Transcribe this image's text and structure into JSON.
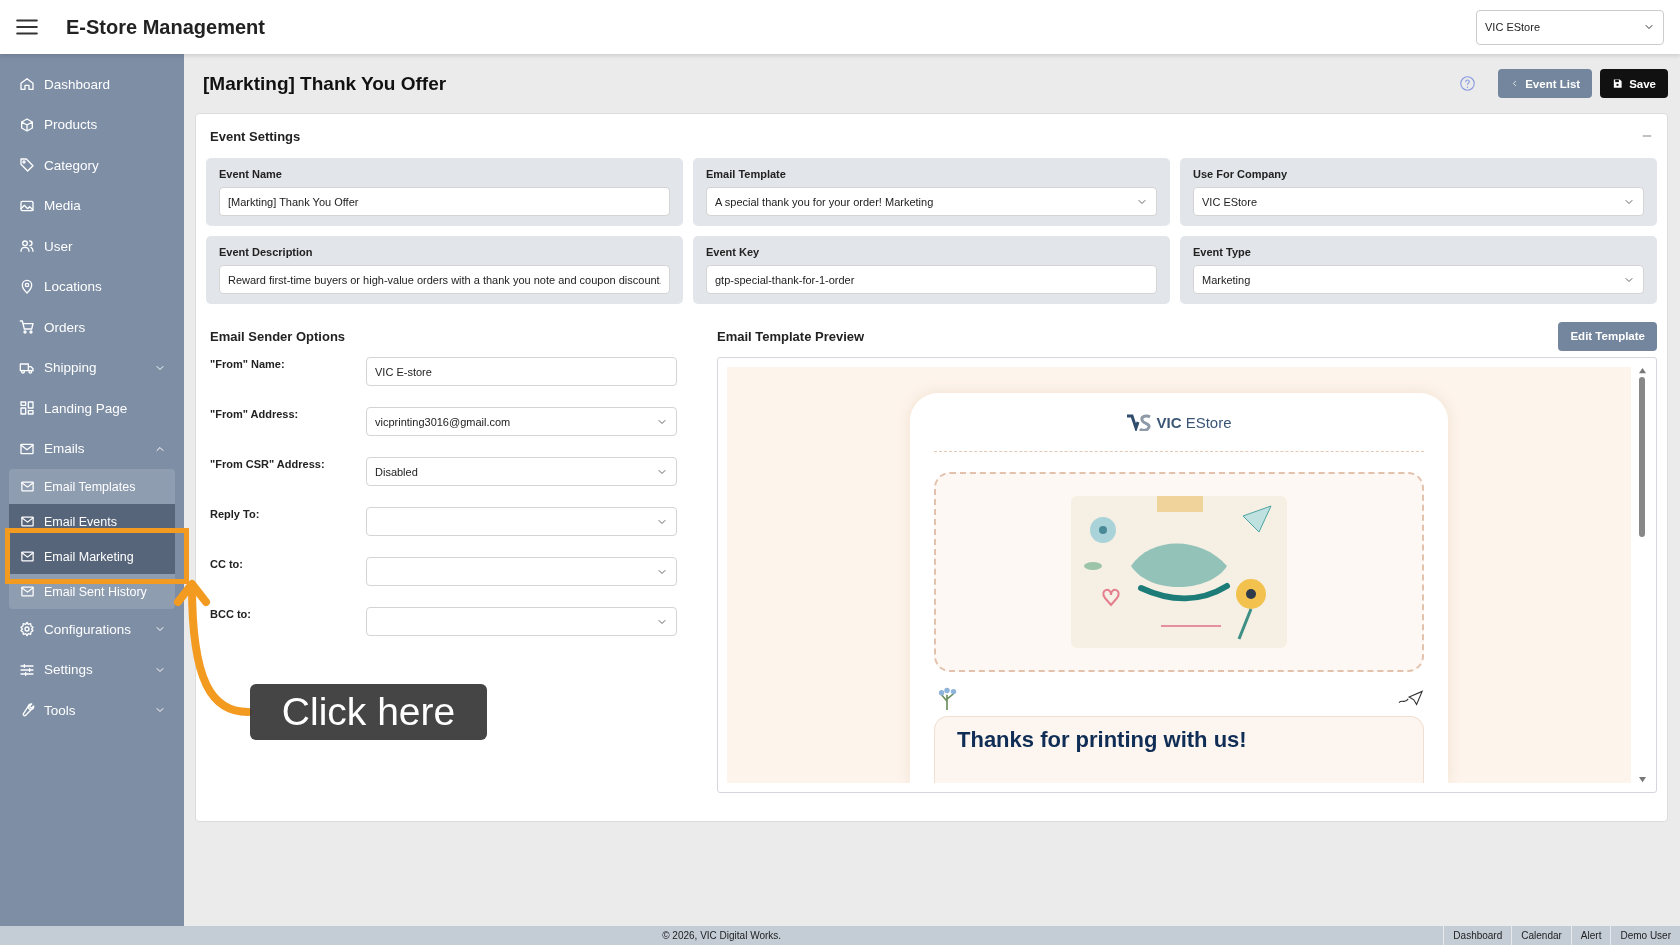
{
  "header": {
    "title": "E-Store Management",
    "store_select": "VIC EStore"
  },
  "sidebar": {
    "items": [
      {
        "kind": "link",
        "label": "Dashboard"
      },
      {
        "kind": "link",
        "label": "Products"
      },
      {
        "kind": "link",
        "label": "Category"
      },
      {
        "kind": "link",
        "label": "Media"
      },
      {
        "kind": "link",
        "label": "User"
      },
      {
        "kind": "link",
        "label": "Locations"
      },
      {
        "kind": "link",
        "label": "Orders"
      },
      {
        "kind": "group",
        "label": "Shipping",
        "expanded": false
      },
      {
        "kind": "link",
        "label": "Landing Page"
      },
      {
        "kind": "group",
        "label": "Emails",
        "expanded": true,
        "children": [
          {
            "label": "Email Templates",
            "selected": false
          },
          {
            "label": "Email Events",
            "selected": true
          },
          {
            "label": "Email Marketing",
            "selected": true
          },
          {
            "label": "Email Sent History",
            "selected": false
          }
        ]
      },
      {
        "kind": "group",
        "label": "Configurations",
        "expanded": false
      },
      {
        "kind": "group",
        "label": "Settings",
        "expanded": false
      },
      {
        "kind": "group",
        "label": "Tools",
        "expanded": false
      }
    ]
  },
  "page": {
    "title": "[Markting] Thank You Offer",
    "buttons": [
      {
        "kind": "back",
        "label": "Event List"
      },
      {
        "kind": "save",
        "label": "Save"
      }
    ]
  },
  "event_settings": {
    "title": "Event Settings",
    "fields": [
      {
        "kind": "input",
        "label": "Event Name",
        "value": "[Markting] Thank You Offer"
      },
      {
        "kind": "select",
        "label": "Email Template",
        "value": "A special thank you for your order! Marketing"
      },
      {
        "kind": "select",
        "label": "Use For Company",
        "value": "VIC EStore"
      },
      {
        "kind": "input",
        "label": "Event Description",
        "value": "Reward first-time buyers or high-value orders with a thank you note and coupon discount."
      },
      {
        "kind": "input",
        "label": "Event Key",
        "value": "gtp-special-thank-for-1-order"
      },
      {
        "kind": "select",
        "label": "Event Type",
        "value": "Marketing"
      }
    ]
  },
  "sender_options": {
    "title": "Email Sender Options",
    "rows": [
      {
        "kind": "input",
        "label": "\"From\" Name:",
        "value": "VIC E-store"
      },
      {
        "kind": "select",
        "label": "\"From\" Address:",
        "value": "vicprinting3016@gmail.com"
      },
      {
        "kind": "select",
        "label": "\"From CSR\" Address:",
        "value": "Disabled"
      },
      {
        "kind": "select",
        "label": "Reply To:"
      },
      {
        "kind": "select",
        "label": "CC to:"
      },
      {
        "kind": "select",
        "label": "BCC to:"
      }
    ]
  },
  "preview": {
    "title": "Email Template Preview",
    "button": "Edit Template",
    "logo_text": "**VIC** EStore",
    "heading": "Thanks for printing with us!"
  },
  "footer": {
    "copyright": "© 2026, VIC Digital Works.",
    "links": [
      "Dashboard",
      "Calendar",
      "Alert",
      "Demo User"
    ]
  },
  "callout": {
    "text": "Click here"
  }
}
